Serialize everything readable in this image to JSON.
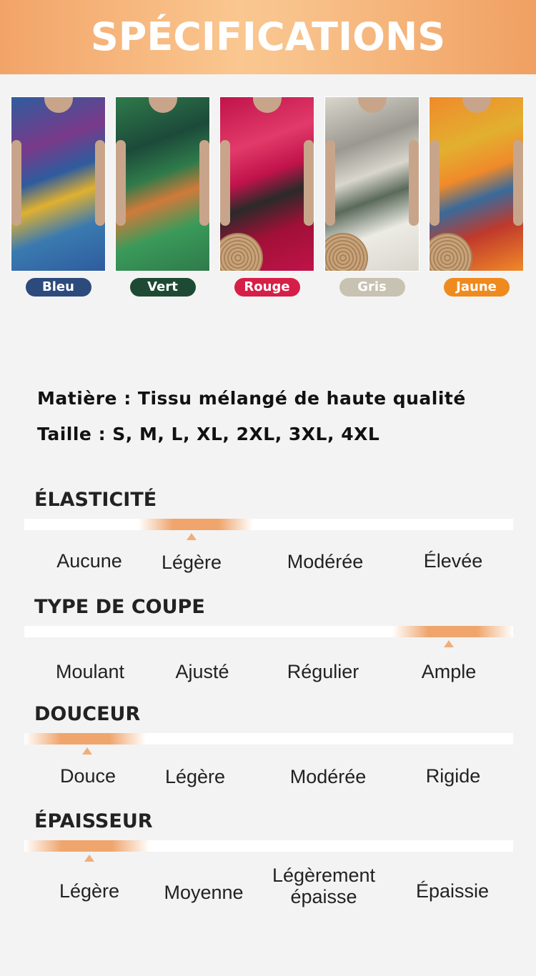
{
  "header": {
    "title": "SPÉCIFICATIONS"
  },
  "colors": [
    {
      "label": "Bleu",
      "pill_color": "#2c4a7c",
      "dress_colors": [
        "#2e5c9e",
        "#7a3a8a",
        "#e0b030",
        "#3a7ab0"
      ]
    },
    {
      "label": "Vert",
      "pill_color": "#1e4a34",
      "dress_colors": [
        "#2f7a4a",
        "#1c4a3a",
        "#d07a3a",
        "#3a9a5a"
      ]
    },
    {
      "label": "Rouge",
      "pill_color": "#d61f48",
      "dress_colors": [
        "#c0134a",
        "#e23a6a",
        "#2a2a2a",
        "#a01036"
      ]
    },
    {
      "label": "Gris",
      "pill_color": "#c8c2b2",
      "dress_colors": [
        "#d9d6cc",
        "#9a9890",
        "#5a6a5a",
        "#ecebe4"
      ]
    },
    {
      "label": "Jaune",
      "pill_color": "#ef8a1e",
      "dress_colors": [
        "#f08a2a",
        "#e2b030",
        "#3a6a9a",
        "#c0392b"
      ]
    }
  ],
  "specs": {
    "material": "Matière : Tissu mélangé de haute qualité",
    "size": "Taille : S, M, L, XL, 2XL, 3XL, 4XL"
  },
  "scales": [
    {
      "title": "ÉLASTICITÉ",
      "options": [
        "Aucune",
        "Légère",
        "Modérée",
        "Élevée"
      ],
      "selected_index": 1
    },
    {
      "title": "TYPE DE COUPE",
      "options": [
        "Moulant",
        "Ajusté",
        "Régulier",
        "Ample"
      ],
      "selected_index": 3
    },
    {
      "title": "DOUCEUR",
      "options": [
        "Douce",
        "Légère",
        "Modérée",
        "Rigide"
      ],
      "selected_index": 0
    },
    {
      "title": "ÉPAISSEUR",
      "options": [
        "Légère",
        "Moyenne",
        "Légèrement\népaisse",
        "Épaissie"
      ],
      "selected_index": 0
    }
  ],
  "theme": {
    "accent": "#efa56c",
    "header_text": "#ffffff"
  }
}
